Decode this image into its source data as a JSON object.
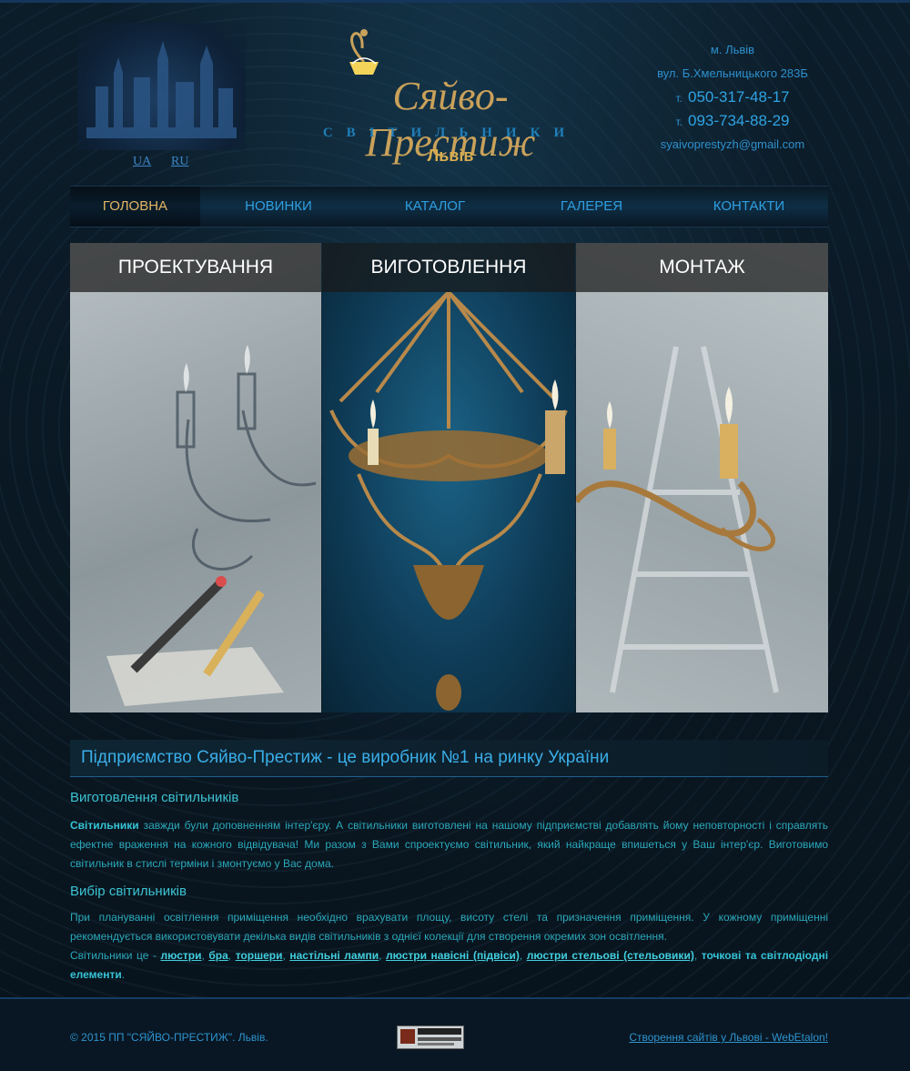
{
  "header": {
    "lang_ua": "UA",
    "lang_ru": "RU",
    "logo_title": "Сяйво-Престиж",
    "logo_subtitle": "СВІТИЛЬНИКИ",
    "logo_city": "Львів",
    "contacts": {
      "city": "м. Львів",
      "address": "вул. Б.Хмельницького 283Б",
      "phone_prefix": "т.",
      "phone1": "050-317-48-17",
      "phone2": "093-734-88-29",
      "email": "syaivoprestyzh@gmail.com"
    }
  },
  "nav": {
    "items": [
      {
        "label": "ГОЛОВНА",
        "active": true
      },
      {
        "label": "НОВИНКИ"
      },
      {
        "label": "КАТАЛОГ"
      },
      {
        "label": "ГАЛЕРЕЯ"
      },
      {
        "label": "КОНТАКТИ"
      }
    ]
  },
  "panels": [
    {
      "title": "ПРОЕКТУВАННЯ"
    },
    {
      "title": "ВИГОТОВЛЕННЯ"
    },
    {
      "title": "МОНТАЖ"
    }
  ],
  "content": {
    "headline": "Підприємство Сяйво-Престиж - це виробник №1 на ринку України",
    "section1_title": "Виготовлення світильників",
    "section1_bold": "Світильники",
    "section1_text": " завжди були доповненням інтер'єру. А світильники виготовлені на нашому підприємстві добавлять йому неповторності і справлять ефектне враження на кожного відвідувача! Ми разом з Вами спроектуємо світильник, який найкраще впишеться у Ваш інтер'єр. Виготовимо світильник в стислі терміни і змонтуємо у Вас дома.",
    "section2_title": "Вибір світильників",
    "section2_text": "При плануванні освітлення приміщення необхідно врахувати площу, висоту стелі та призначення приміщення. У кожному приміщенні рекомендується використовувати декілька видів світильників з однієї колекції для створення окремих зон освітлення.",
    "section2_lead": "Світильники це - ",
    "links": [
      "люстри",
      "бра",
      "торшери",
      "настільні лампи",
      "люстри навісні (підвіси)",
      "люстри стельові (стельовики)"
    ],
    "section2_tail_bold": "точкові та світлодіодні елементи"
  },
  "footer": {
    "copyright": "© 2015 ПП \"СЯЙВО-ПРЕСТИЖ\". Львів.",
    "dev_link": "Створення сайтів у Львові - WebEtalon!"
  },
  "colors": {
    "background": "#0a1822",
    "accent_blue": "#2f9fe0",
    "accent_gold": "#e5b564",
    "text_teal": "#2ba9bb"
  }
}
